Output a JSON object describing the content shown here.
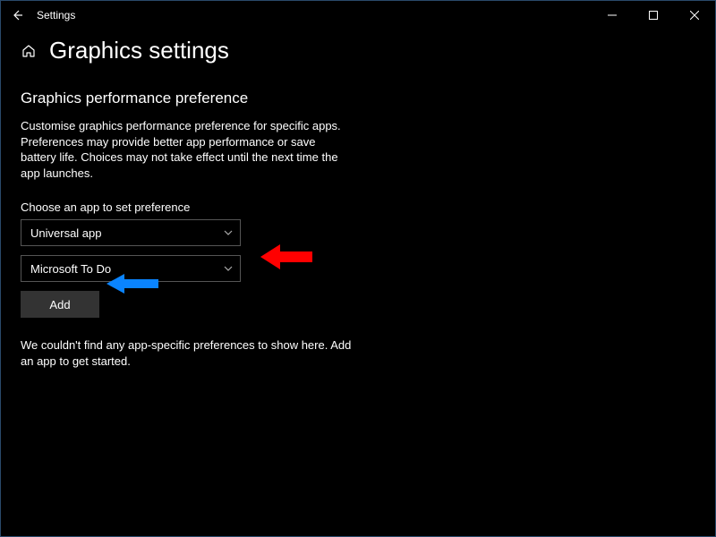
{
  "titlebar": {
    "app_title": "Settings"
  },
  "page": {
    "title": "Graphics settings"
  },
  "section": {
    "heading": "Graphics performance preference",
    "description": "Customise graphics performance preference for specific apps. Preferences may provide better app performance or save battery life. Choices may not take effect until the next time the app launches."
  },
  "form": {
    "choose_label": "Choose an app to set preference",
    "app_type_selected": "Universal app",
    "app_selected": "Microsoft To Do",
    "add_button": "Add"
  },
  "empty_state": "We couldn't find any app-specific preferences to show here. Add an app to get started.",
  "annotations": {
    "red_arrow_color": "#ff0000",
    "blue_arrow_color": "#0a84ff"
  }
}
